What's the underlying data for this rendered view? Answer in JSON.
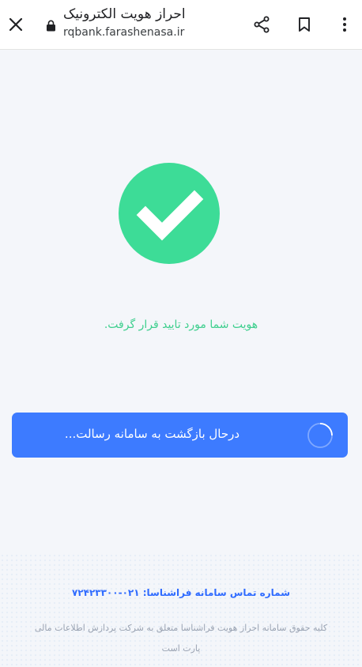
{
  "browser": {
    "page_title": "احراز هویت الکترونیک",
    "url": "rqbank.farashenasa.ir",
    "icons": {
      "close": "close-icon",
      "lock": "lock-icon",
      "share": "share-icon",
      "bookmark": "bookmark-icon",
      "menu": "more-vert-icon"
    }
  },
  "main": {
    "success_icon": "check-circle-icon",
    "success_message": "هویت شما مورد تایید قرار گرفت.",
    "return_status": "درحال بازگشت به سامانه رسالت...",
    "spinner_icon": "loading-spinner-icon"
  },
  "footer": {
    "contact_label": "شماره تماس سامانه فراشناسا:",
    "contact_number": "۰۲۱-۷۲۴۲۳۳۰۰",
    "copyright_line1": "کلیه حقوق سامانه احراز هویت فراشناسا متعلق به شرکت پردازش اطلاعات مالی",
    "copyright_line2": "پارت است"
  },
  "colors": {
    "success_green": "#3ddc97",
    "primary_blue": "#3d7bff",
    "success_text": "#3ecf8e",
    "footer_text": "#9aa3b2"
  }
}
